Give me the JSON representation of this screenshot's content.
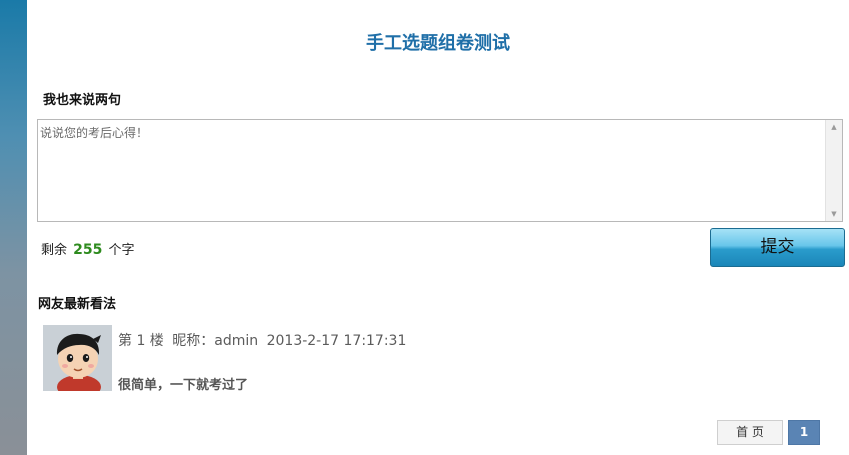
{
  "page": {
    "title": "手工选题组卷测试"
  },
  "comment_form": {
    "heading": "我也来说两句",
    "textarea_placeholder": "说说您的考后心得！",
    "remaining_prefix": "剩余",
    "remaining_count": "255",
    "remaining_suffix": "个字",
    "submit_label": "提交"
  },
  "comments": {
    "heading": "网友最新看法",
    "items": [
      {
        "floor": "第 1 楼",
        "nickname_label": "昵称：admin",
        "timestamp": "2013-2-17 17:17:31",
        "text": "很简单，一下就考过了"
      }
    ]
  },
  "pagination": {
    "first_label": "首 页",
    "current_page": "1"
  },
  "colors": {
    "title": "#1f6fa8",
    "count_green": "#2e8b1e",
    "submit_gradient_top": "#a6e2f6",
    "submit_gradient_bottom": "#1b86b8",
    "pager_active": "#5a84b4"
  }
}
